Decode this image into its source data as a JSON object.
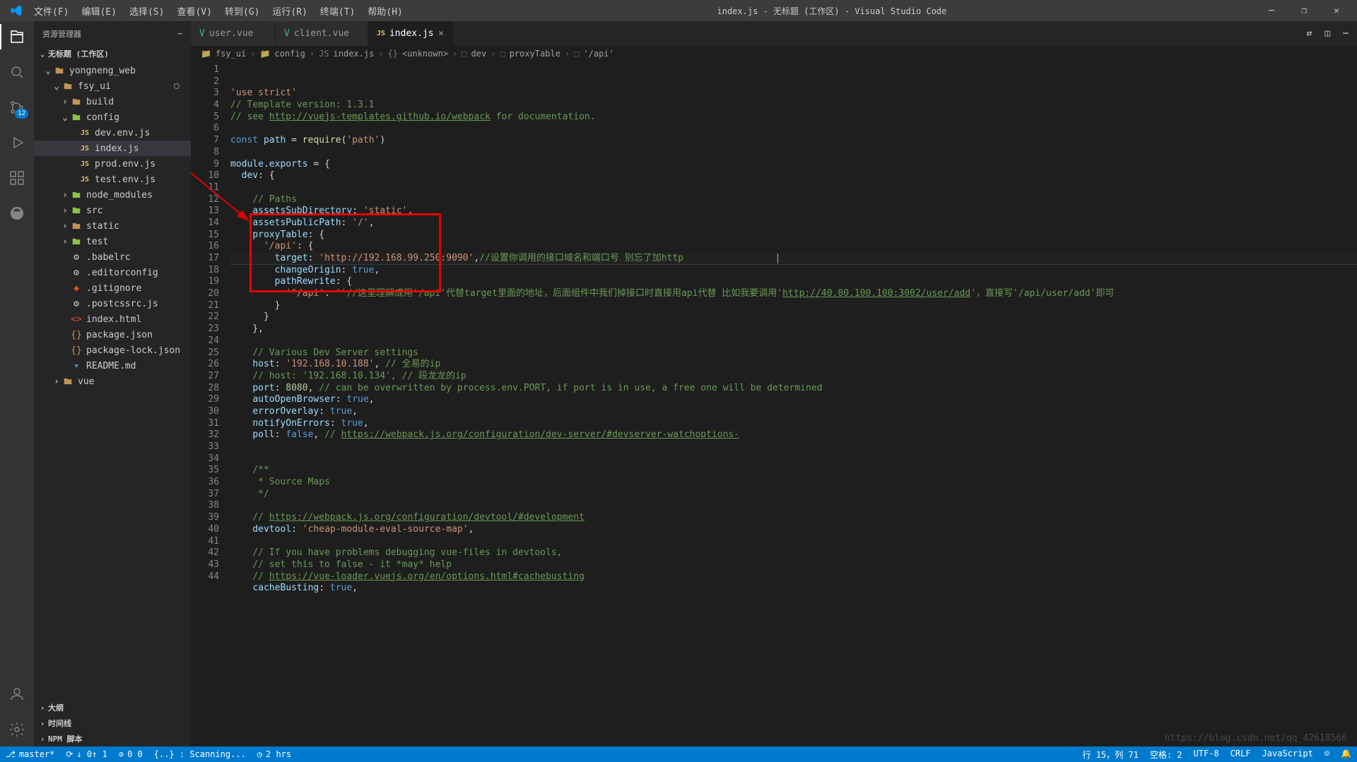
{
  "window": {
    "title": "index.js - 无标题 (工作区) - Visual Studio Code"
  },
  "menu": [
    "文件(F)",
    "编辑(E)",
    "选择(S)",
    "查看(V)",
    "转到(G)",
    "运行(R)",
    "终端(T)",
    "帮助(H)"
  ],
  "sidebar": {
    "title": "资源管理器",
    "workspace": "无标题 (工作区)",
    "tree": [
      {
        "d": 1,
        "t": "folder",
        "open": true,
        "name": "yongneng_web",
        "cls": "ic-folder"
      },
      {
        "d": 2,
        "t": "folder",
        "open": true,
        "name": "fsy_ui",
        "mod": true,
        "cls": "ic-folder"
      },
      {
        "d": 3,
        "t": "folder",
        "open": false,
        "name": "build",
        "cls": "ic-folder"
      },
      {
        "d": 3,
        "t": "folder",
        "open": true,
        "name": "config",
        "cls": "ic-folder-green"
      },
      {
        "d": 4,
        "t": "file",
        "name": "dev.env.js",
        "ic": "JS",
        "cls": "ic-js"
      },
      {
        "d": 4,
        "t": "file",
        "name": "index.js",
        "ic": "JS",
        "cls": "ic-js",
        "sel": true
      },
      {
        "d": 4,
        "t": "file",
        "name": "prod.env.js",
        "ic": "JS",
        "cls": "ic-js"
      },
      {
        "d": 4,
        "t": "file",
        "name": "test.env.js",
        "ic": "JS",
        "cls": "ic-js"
      },
      {
        "d": 3,
        "t": "folder",
        "open": false,
        "name": "node_modules",
        "cls": "ic-folder-green"
      },
      {
        "d": 3,
        "t": "folder",
        "open": false,
        "name": "src",
        "cls": "ic-folder-green"
      },
      {
        "d": 3,
        "t": "folder",
        "open": false,
        "name": "static",
        "cls": "ic-folder"
      },
      {
        "d": 3,
        "t": "folder",
        "open": false,
        "name": "test",
        "cls": "ic-folder-green"
      },
      {
        "d": 3,
        "t": "file",
        "name": ".babelrc",
        "ic": "⚙",
        "cls": "ic-txt"
      },
      {
        "d": 3,
        "t": "file",
        "name": ".editorconfig",
        "ic": "⚙",
        "cls": "ic-txt"
      },
      {
        "d": 3,
        "t": "file",
        "name": ".gitignore",
        "ic": "◆",
        "cls": "ic-git"
      },
      {
        "d": 3,
        "t": "file",
        "name": ".postcssrc.js",
        "ic": "⚙",
        "cls": "ic-txt"
      },
      {
        "d": 3,
        "t": "file",
        "name": "index.html",
        "ic": "<>",
        "cls": "ic-html"
      },
      {
        "d": 3,
        "t": "file",
        "name": "package.json",
        "ic": "{}",
        "cls": "ic-json"
      },
      {
        "d": 3,
        "t": "file",
        "name": "package-lock.json",
        "ic": "{}",
        "cls": "ic-json"
      },
      {
        "d": 3,
        "t": "file",
        "name": "README.md",
        "ic": "▾",
        "cls": "ic-md"
      },
      {
        "d": 2,
        "t": "folder",
        "open": false,
        "name": "vue",
        "cls": "ic-folder"
      }
    ],
    "panels": [
      "大纲",
      "时间线",
      "NPM 脚本"
    ]
  },
  "activity_badge": "12",
  "tabs": [
    {
      "icon": "V",
      "cls": "ic-vue",
      "label": "user.vue",
      "active": false
    },
    {
      "icon": "V",
      "cls": "ic-vue",
      "label": "client.vue",
      "active": false
    },
    {
      "icon": "JS",
      "cls": "ic-js",
      "label": "index.js",
      "active": true
    }
  ],
  "breadcrumb": [
    "fsy_ui",
    "config",
    "index.js",
    "<unknown>",
    "dev",
    "proxyTable",
    "'/api'"
  ],
  "code_lines": [
    {
      "n": 1,
      "h": "<span class='c-str'>'use strict'</span>"
    },
    {
      "n": 2,
      "h": "<span class='c-cm'>// Template version: 1.3.1</span>"
    },
    {
      "n": 3,
      "h": "<span class='c-cm'>// see <span class='c-link'>http://vuejs-templates.github.io/webpack</span> for documentation.</span>"
    },
    {
      "n": 4,
      "h": ""
    },
    {
      "n": 5,
      "h": "<span class='c-kw'>const</span> <span class='c-prop'>path</span> = <span class='c-fn'>require</span>(<span class='c-str'>'path'</span>)"
    },
    {
      "n": 6,
      "h": ""
    },
    {
      "n": 7,
      "h": "<span class='c-prop'>module</span>.<span class='c-prop'>exports</span> = {"
    },
    {
      "n": 8,
      "h": "  <span class='c-prop'>dev</span>: {"
    },
    {
      "n": 9,
      "h": ""
    },
    {
      "n": 10,
      "h": "    <span class='c-cm'>// Paths</span>"
    },
    {
      "n": 11,
      "h": "    <span class='c-prop'>assetsSubDirectory</span>: <span class='c-str'>'static'</span>,"
    },
    {
      "n": 12,
      "h": "    <span class='c-prop'>assetsPublicPath</span>: <span class='c-str'>'/'</span>,"
    },
    {
      "n": 13,
      "h": "    <span class='c-prop'>proxyTable</span>: {"
    },
    {
      "n": 14,
      "h": "      <span class='c-str'>'/api'</span>: {"
    },
    {
      "n": 15,
      "h": "        <span class='c-prop'>target</span>: <span class='c-str'>'http://192.168.99.250:9090'</span>,<span class='c-cm'>//设置你调用的接口域名和端口号 别忘了加http</span>                 <span class='cursor-caret'></span>",
      "cur": true
    },
    {
      "n": 16,
      "h": "        <span class='c-prop'>changeOrigin</span>: <span class='c-lit'>true</span>,"
    },
    {
      "n": 17,
      "h": "        <span class='c-prop'>pathRewrite</span>: {"
    },
    {
      "n": 18,
      "h": "          <span class='c-str'>'^/api'</span>: <span class='c-str'>''</span><span class='c-cm'>//这里理解成用'/api'代替target里面的地址，后面组件中我们掉接口时直接用api代替 比如我要调用'<span class='c-link'>http://40.00.100.100:3002/user/add</span>'，直接写'/api/user/add'即可</span>"
    },
    {
      "n": 19,
      "h": "        }"
    },
    {
      "n": 20,
      "h": "      }"
    },
    {
      "n": 21,
      "h": "    },"
    },
    {
      "n": 22,
      "h": ""
    },
    {
      "n": 23,
      "h": "    <span class='c-cm'>// Various Dev Server settings</span>"
    },
    {
      "n": 24,
      "h": "    <span class='c-prop'>host</span>: <span class='c-str'>'192.168.10.188'</span>, <span class='c-cm'>// 全易的ip</span>"
    },
    {
      "n": 25,
      "h": "    <span class='c-cm'>// host: '192.168.10.134', // 段龙龙的ip</span>"
    },
    {
      "n": 26,
      "h": "    <span class='c-prop'>port</span>: <span class='c-num'>8080</span>, <span class='c-cm'>// can be overwritten by process.env.PORT, if port is in use, a free one will be determined</span>"
    },
    {
      "n": 27,
      "h": "    <span class='c-prop'>autoOpenBrowser</span>: <span class='c-lit'>true</span>,"
    },
    {
      "n": 28,
      "h": "    <span class='c-prop'>errorOverlay</span>: <span class='c-lit'>true</span>,"
    },
    {
      "n": 29,
      "h": "    <span class='c-prop'>notifyOnErrors</span>: <span class='c-lit'>true</span>,"
    },
    {
      "n": 30,
      "h": "    <span class='c-prop'>poll</span>: <span class='c-lit'>false</span>, <span class='c-cm'>// <span class='c-link'>https://webpack.js.org/configuration/dev-server/#devserver-watchoptions-</span></span>"
    },
    {
      "n": 31,
      "h": ""
    },
    {
      "n": 32,
      "h": ""
    },
    {
      "n": 33,
      "h": "    <span class='c-cm'>/**</span>"
    },
    {
      "n": 34,
      "h": "<span class='c-cm'>     * Source Maps</span>"
    },
    {
      "n": 35,
      "h": "<span class='c-cm'>     */</span>"
    },
    {
      "n": 36,
      "h": ""
    },
    {
      "n": 37,
      "h": "    <span class='c-cm'>// <span class='c-link'>https://webpack.js.org/configuration/devtool/#development</span></span>"
    },
    {
      "n": 38,
      "h": "    <span class='c-prop'>devtool</span>: <span class='c-str'>'cheap-module-eval-source-map'</span>,"
    },
    {
      "n": 39,
      "h": ""
    },
    {
      "n": 40,
      "h": "    <span class='c-cm'>// If you have problems debugging vue-files in devtools,</span>"
    },
    {
      "n": 41,
      "h": "    <span class='c-cm'>// set this to false - it *may* help</span>"
    },
    {
      "n": 42,
      "h": "    <span class='c-cm'>// <span class='c-link'>https://vue-loader.vuejs.org/en/options.html#cachebusting</span></span>"
    },
    {
      "n": 43,
      "h": "    <span class='c-prop'>cacheBusting</span>: <span class='c-lit'>true</span>,"
    },
    {
      "n": 44,
      "h": ""
    }
  ],
  "status": {
    "branch": "master*",
    "sync": "↓ 0↑ 1",
    "problems": "0  0",
    "scan": "{..} : Scanning...",
    "clock": "2 hrs",
    "pos": "行 15，列 71",
    "spaces": "空格: 2",
    "enc": "UTF-8",
    "eol": "CRLF",
    "lang": "JavaScript",
    "feedback": "☺",
    "bell": "🔔"
  },
  "watermark": "https://blog.csdn.net/qq_42618566"
}
